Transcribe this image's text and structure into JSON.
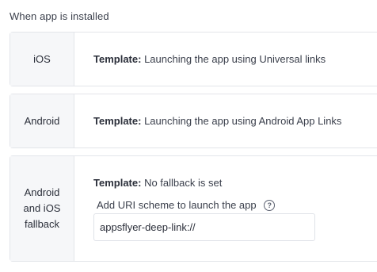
{
  "section": {
    "title": "When app is installed"
  },
  "rows": [
    {
      "label": "iOS",
      "template_key": "Template:",
      "template_value": "Launching the app using Universal links"
    },
    {
      "label": "Android",
      "template_key": "Template:",
      "template_value": "Launching the app using Android App Links"
    },
    {
      "label_lines": [
        "Android",
        "and iOS",
        "fallback"
      ],
      "template_key": "Template:",
      "template_value": "No fallback is set",
      "uri_label": "Add URI scheme to launch the app",
      "help_icon": "question-circle-icon",
      "help_glyph": "?",
      "uri_value": "appsflyer-deep-link://"
    }
  ],
  "colors": {
    "label_bg": "#f6f7f9",
    "border": "#e3e5ea",
    "text": "#2b2f3a"
  }
}
